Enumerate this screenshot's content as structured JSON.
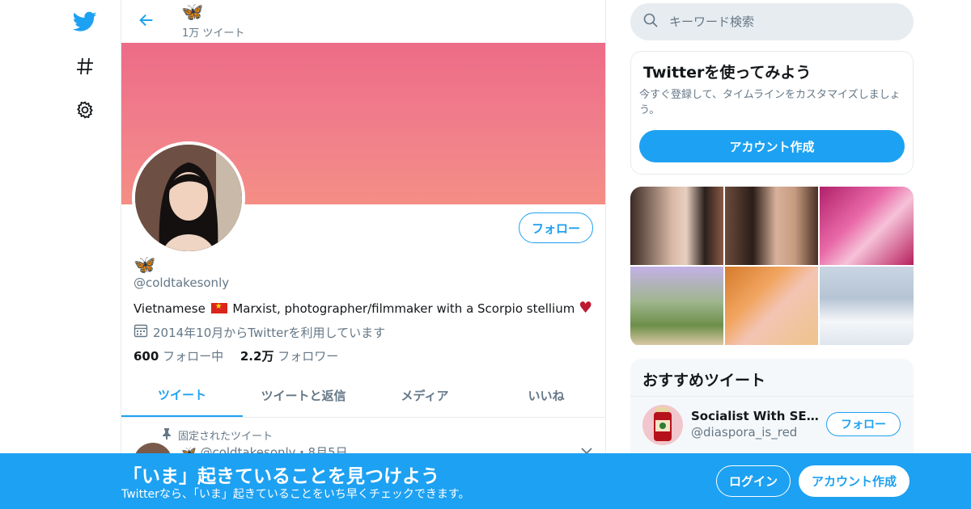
{
  "nav": {
    "icons": [
      "twitter-bird-icon",
      "hashtag-icon",
      "gear-icon"
    ]
  },
  "header": {
    "display_name": "🦋",
    "tweet_count": "1万 ツイート"
  },
  "profile": {
    "follow_label": "フォロー",
    "display_name": "🦋",
    "handle": "@coldtakesonly",
    "bio_before_flag": "Vietnamese ",
    "bio_after_flag": " Marxist, photographer/filmmaker with a Scorpio stellium ",
    "bio_heart": "♥",
    "joined": "2014年10月からTwitterを利用しています",
    "following_count": "600",
    "following_label": " フォロー中",
    "followers_count": "2.2万",
    "followers_label": " フォロワー"
  },
  "tabs": [
    {
      "label": "ツイート",
      "active": true
    },
    {
      "label": "ツイートと返信",
      "active": false
    },
    {
      "label": "メディア",
      "active": false
    },
    {
      "label": "いいね",
      "active": false
    }
  ],
  "pinned_tweet": {
    "label": "固定されたツイート",
    "meta": "🦋 @coldtakesonly・8月5日"
  },
  "search": {
    "placeholder": "キーワード検索"
  },
  "signup_card": {
    "title": "Twitterを使ってみよう",
    "description": "今すぐ登録して、タイムラインをカスタマイズしましょう。",
    "button": "アカウント作成"
  },
  "recommended": {
    "title": "おすすめツイート",
    "items": [
      {
        "name": "Socialist With SE Asi...",
        "handle": "@diaspora_is_red",
        "follow_label": "フォロー"
      }
    ]
  },
  "bottom_bar": {
    "title": "「いま」起きていることを見つけよう",
    "subtitle": "Twitterなら、「いま」起きていることをいち早くチェックできます。",
    "login": "ログイン",
    "signup": "アカウント作成"
  },
  "colors": {
    "accent": "#1da1f2",
    "banner": "#ef7488",
    "muted_text": "#657786"
  }
}
